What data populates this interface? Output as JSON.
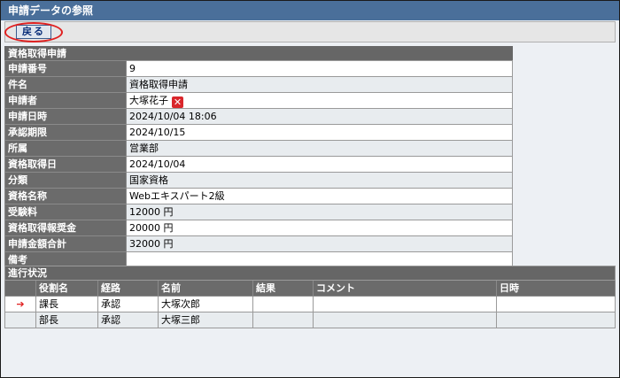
{
  "title": "申請データの参照",
  "toolbar": {
    "back_label": "戻る"
  },
  "detail": {
    "section_title": "資格取得申請",
    "applicant_icon": "cancel-icon",
    "rows": [
      {
        "label": "申請番号",
        "value": "9"
      },
      {
        "label": "件名",
        "value": "資格取得申請"
      },
      {
        "label": "申請者",
        "value": "大塚花子"
      },
      {
        "label": "申請日時",
        "value": "2024/10/04 18:06"
      },
      {
        "label": "承認期限",
        "value": "2024/10/15"
      },
      {
        "label": "所属",
        "value": "営業部"
      },
      {
        "label": "資格取得日",
        "value": "2024/10/04"
      },
      {
        "label": "分類",
        "value": "国家資格"
      },
      {
        "label": "資格名称",
        "value": "Webエキスパート2級"
      },
      {
        "label": "受験料",
        "value": "12000 円"
      },
      {
        "label": "資格取得報奨金",
        "value": "20000 円"
      },
      {
        "label": "申請金額合計",
        "value": "32000 円"
      },
      {
        "label": "備考",
        "value": ""
      }
    ]
  },
  "progress": {
    "section_title": "進行状況",
    "headers": [
      "役割名",
      "経路",
      "名前",
      "結果",
      "コメント",
      "日時"
    ],
    "rows": [
      {
        "role": "課長",
        "route": "承認",
        "name": "大塚次郎",
        "result": "",
        "comment": "",
        "datetime": "",
        "current": true
      },
      {
        "role": "部長",
        "route": "承認",
        "name": "大塚三郎",
        "result": "",
        "comment": "",
        "datetime": "",
        "current": false
      }
    ],
    "current_marker": "➔"
  }
}
